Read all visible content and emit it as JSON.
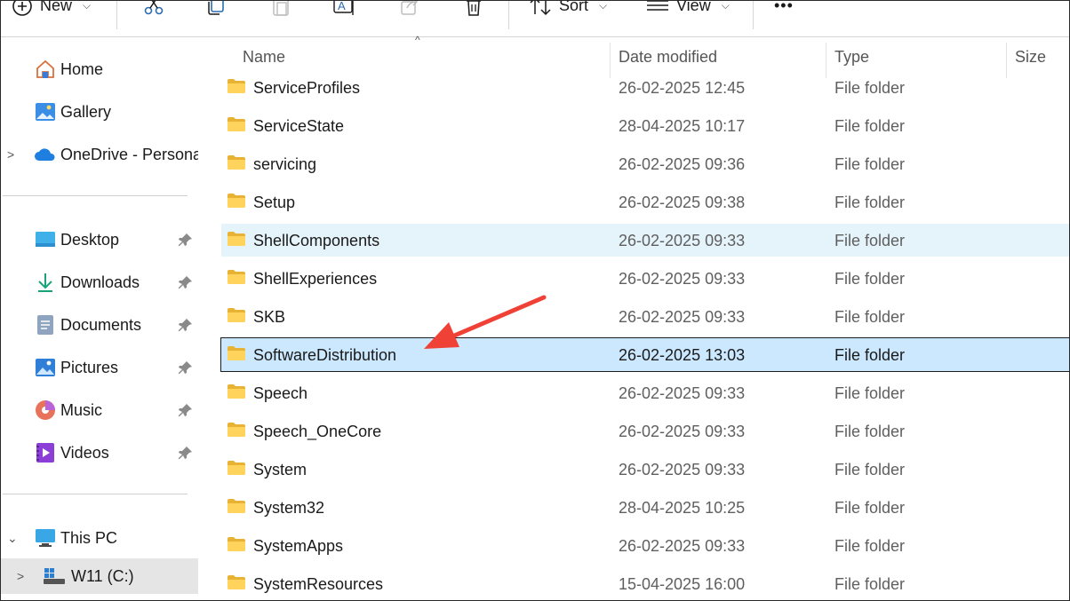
{
  "toolbar": {
    "new_label": "New",
    "sort_label": "Sort",
    "view_label": "View",
    "more_label": "•••"
  },
  "sidebar": {
    "items": [
      {
        "label": "Home",
        "icon": "home-icon"
      },
      {
        "label": "Gallery",
        "icon": "gallery-icon"
      },
      {
        "label": "OneDrive - Persona",
        "icon": "onedrive-icon"
      }
    ],
    "quick": [
      {
        "label": "Desktop",
        "icon": "desktop-icon"
      },
      {
        "label": "Downloads",
        "icon": "downloads-icon"
      },
      {
        "label": "Documents",
        "icon": "documents-icon"
      },
      {
        "label": "Pictures",
        "icon": "pictures-icon"
      },
      {
        "label": "Music",
        "icon": "music-icon"
      },
      {
        "label": "Videos",
        "icon": "videos-icon"
      }
    ],
    "this_pc": {
      "label": "This PC",
      "icon": "this-pc-icon"
    },
    "drive": {
      "label": "W11 (C:)",
      "icon": "windows-drive-icon"
    }
  },
  "columns": {
    "name": "Name",
    "date": "Date modified",
    "type": "Type",
    "size": "Size"
  },
  "files": [
    {
      "name": "ServiceProfiles",
      "date": "26-02-2025 12:45",
      "type": "File folder"
    },
    {
      "name": "ServiceState",
      "date": "28-04-2025 10:17",
      "type": "File folder"
    },
    {
      "name": "servicing",
      "date": "26-02-2025 09:36",
      "type": "File folder"
    },
    {
      "name": "Setup",
      "date": "26-02-2025 09:38",
      "type": "File folder"
    },
    {
      "name": "ShellComponents",
      "date": "26-02-2025 09:33",
      "type": "File folder",
      "state": "hover"
    },
    {
      "name": "ShellExperiences",
      "date": "26-02-2025 09:33",
      "type": "File folder"
    },
    {
      "name": "SKB",
      "date": "26-02-2025 09:33",
      "type": "File folder"
    },
    {
      "name": "SoftwareDistribution",
      "date": "26-02-2025 13:03",
      "type": "File folder",
      "state": "selected"
    },
    {
      "name": "Speech",
      "date": "26-02-2025 09:33",
      "type": "File folder"
    },
    {
      "name": "Speech_OneCore",
      "date": "26-02-2025 09:33",
      "type": "File folder"
    },
    {
      "name": "System",
      "date": "26-02-2025 09:33",
      "type": "File folder"
    },
    {
      "name": "System32",
      "date": "28-04-2025 10:25",
      "type": "File folder"
    },
    {
      "name": "SystemApps",
      "date": "26-02-2025 09:33",
      "type": "File folder"
    },
    {
      "name": "SystemResources",
      "date": "15-04-2025 16:00",
      "type": "File folder"
    }
  ],
  "colors": {
    "selected_bg": "#cce8ff",
    "hover_bg": "#e5f3fb",
    "arrow": "#ef4136",
    "folder": "#f7c948"
  }
}
